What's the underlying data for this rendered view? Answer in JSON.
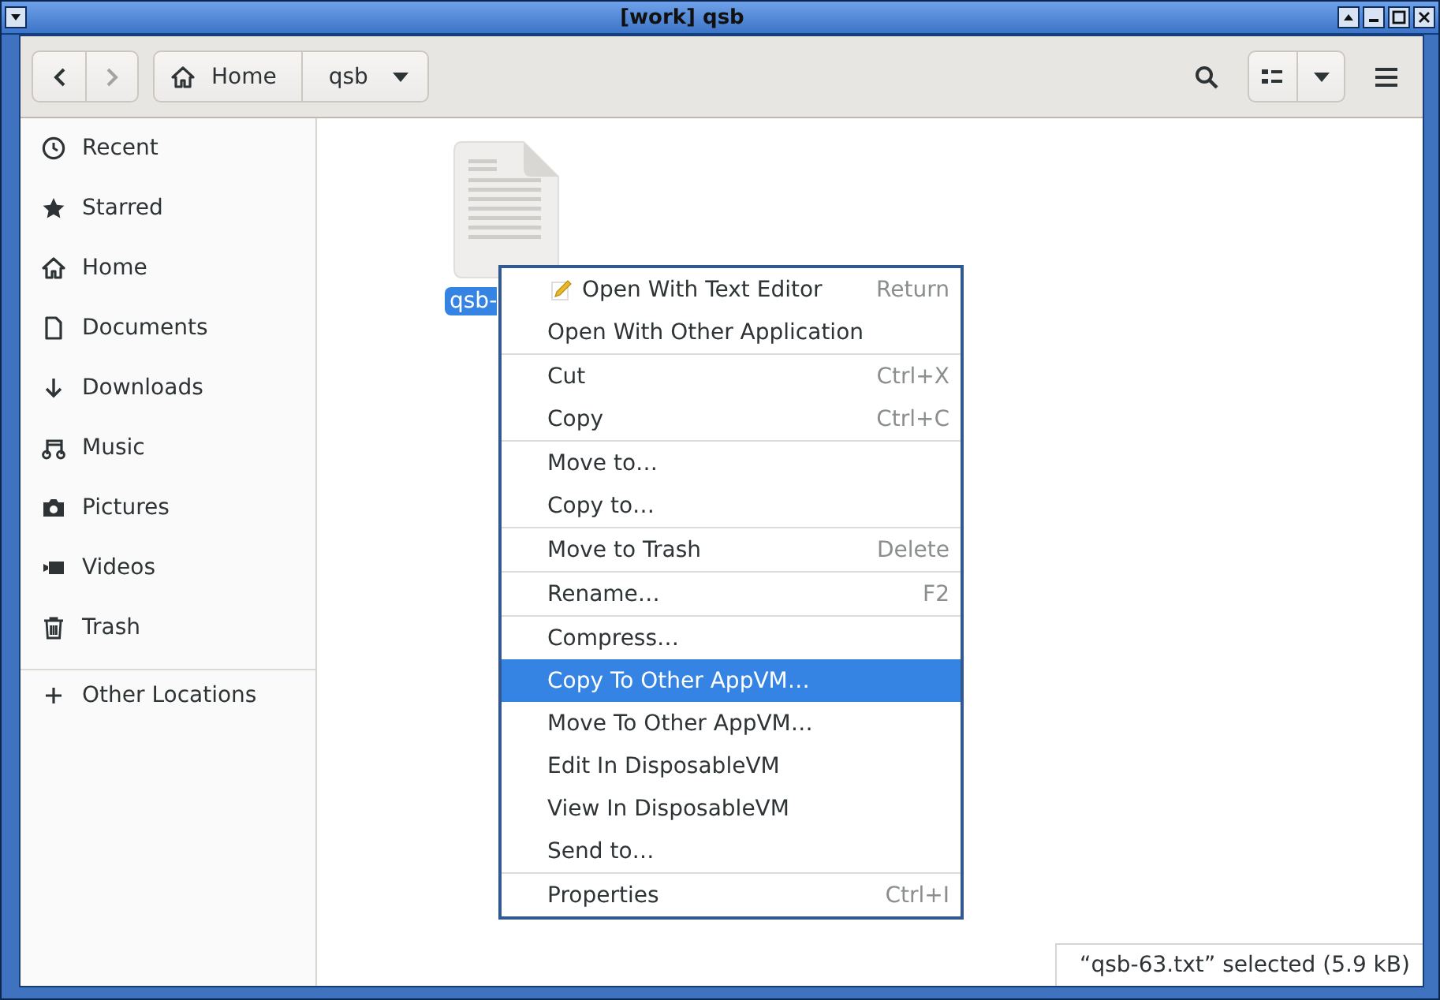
{
  "window": {
    "title": "[work] qsb"
  },
  "headerbar": {
    "path": [
      {
        "label": "Home",
        "kind": "home"
      },
      {
        "label": "qsb",
        "kind": "current"
      }
    ]
  },
  "sidebar": {
    "items": [
      {
        "label": "Recent",
        "selected": false
      },
      {
        "label": "Starred",
        "selected": false
      },
      {
        "label": "Home",
        "selected": false
      },
      {
        "label": "Documents",
        "selected": false
      },
      {
        "label": "Downloads",
        "selected": false
      },
      {
        "label": "Music",
        "selected": false
      },
      {
        "label": "Pictures",
        "selected": false
      },
      {
        "label": "Videos",
        "selected": false
      },
      {
        "label": "Trash",
        "selected": false
      }
    ],
    "other": {
      "label": "Other Locations"
    }
  },
  "files": [
    {
      "name": "qsb-",
      "selected": true
    }
  ],
  "context_menu": {
    "groups": [
      [
        {
          "label": "Open With Text Editor",
          "shortcut": "Return",
          "kind": "app",
          "selected": false
        },
        {
          "label": "Open With Other Application",
          "kind": "plain",
          "selected": false
        }
      ],
      [
        {
          "label": "Cut",
          "shortcut": "Ctrl+X",
          "kind": "plain",
          "selected": false
        },
        {
          "label": "Copy",
          "shortcut": "Ctrl+C",
          "kind": "plain",
          "selected": false
        }
      ],
      [
        {
          "label": "Move to…",
          "kind": "plain",
          "selected": false
        },
        {
          "label": "Copy to…",
          "kind": "plain",
          "selected": false
        }
      ],
      [
        {
          "label": "Move to Trash",
          "shortcut": "Delete",
          "kind": "plain",
          "selected": false
        }
      ],
      [
        {
          "label": "Rename…",
          "shortcut": "F2",
          "kind": "plain",
          "selected": false
        }
      ],
      [
        {
          "label": "Compress…",
          "kind": "plain",
          "selected": false
        },
        {
          "label": "Copy To Other AppVM…",
          "kind": "plain",
          "selected": true
        },
        {
          "label": "Move To Other AppVM…",
          "kind": "plain",
          "selected": false
        },
        {
          "label": "Edit In DisposableVM",
          "kind": "plain",
          "selected": false
        },
        {
          "label": "View In DisposableVM",
          "kind": "plain",
          "selected": false
        },
        {
          "label": "Send to…",
          "kind": "plain",
          "selected": false
        }
      ],
      [
        {
          "label": "Properties",
          "shortcut": "Ctrl+I",
          "kind": "plain",
          "selected": false
        }
      ]
    ]
  },
  "status_bar": {
    "text": "“qsb-63.txt” selected (5.9 kB)"
  }
}
